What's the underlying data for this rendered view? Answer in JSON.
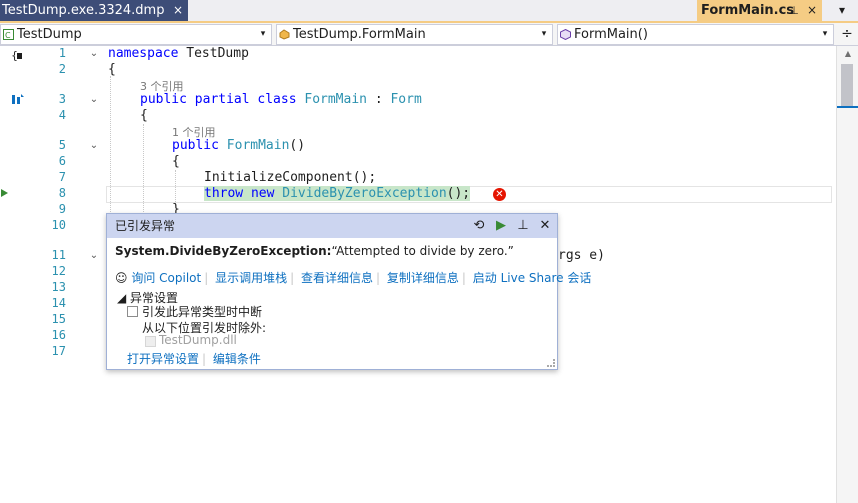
{
  "tabs": {
    "left_file": "TestDump.exe.3324.dmp",
    "left_close": "×",
    "active_file": "FormMain.cs",
    "pin": "⊥",
    "close": "×",
    "menu": "▾"
  },
  "navbar": {
    "project": "TestDump",
    "class": "TestDump.FormMain",
    "member": "FormMain()",
    "dropdown_glyph": "▾",
    "split_glyph": "÷"
  },
  "code": {
    "line_numbers": [
      "1",
      "2",
      "3",
      "4",
      "5",
      "6",
      "7",
      "8",
      "9",
      "10",
      "11",
      "12",
      "13",
      "14",
      "15",
      "16",
      "17"
    ],
    "lens_class_refs": "3 个引用",
    "lens_ctor_refs": "1 个引用",
    "l1_kw": "namespace",
    "l1_name": " TestDump",
    "l2": "{",
    "l3_kw": "public partial class",
    "l3_type": "FormMain",
    "l3_colon": " : ",
    "l3_base": "Form",
    "l4": "{",
    "l5_kw": "public",
    "l5_type": "FormMain",
    "l5_paren": "()",
    "l6": "{",
    "l7": "InitializeComponent();",
    "l8_throw": "throw",
    "l8_new": " new ",
    "l8_type": "DivideByZeroException",
    "l8_rest": "();",
    "l9": "}",
    "l11_tail": "rgs e)",
    "error_glyph": "✕"
  },
  "popup": {
    "title": "已引发异常",
    "history_glyph": "⟲",
    "continue_glyph": "▶",
    "pin_glyph": "⊥",
    "close_glyph": "✕",
    "exception_type": "System.DivideByZeroException:",
    "exception_msg": "“Attempted to divide by zero.”",
    "copilot_icon": "☺",
    "link_copilot": "询问 Copilot",
    "link_callstack": "显示调用堆栈",
    "link_details": "查看详细信息",
    "link_copy": "复制详细信息",
    "link_liveshare": "启动 Live Share 会话",
    "settings_header": "◢ 异常设置",
    "break_label": "引发此异常类型时中断",
    "except_label": "从以下位置引发时除外:",
    "dll_label": "TestDump.dll",
    "link_open_settings": "打开异常设置",
    "link_edit_conditions": "编辑条件"
  }
}
